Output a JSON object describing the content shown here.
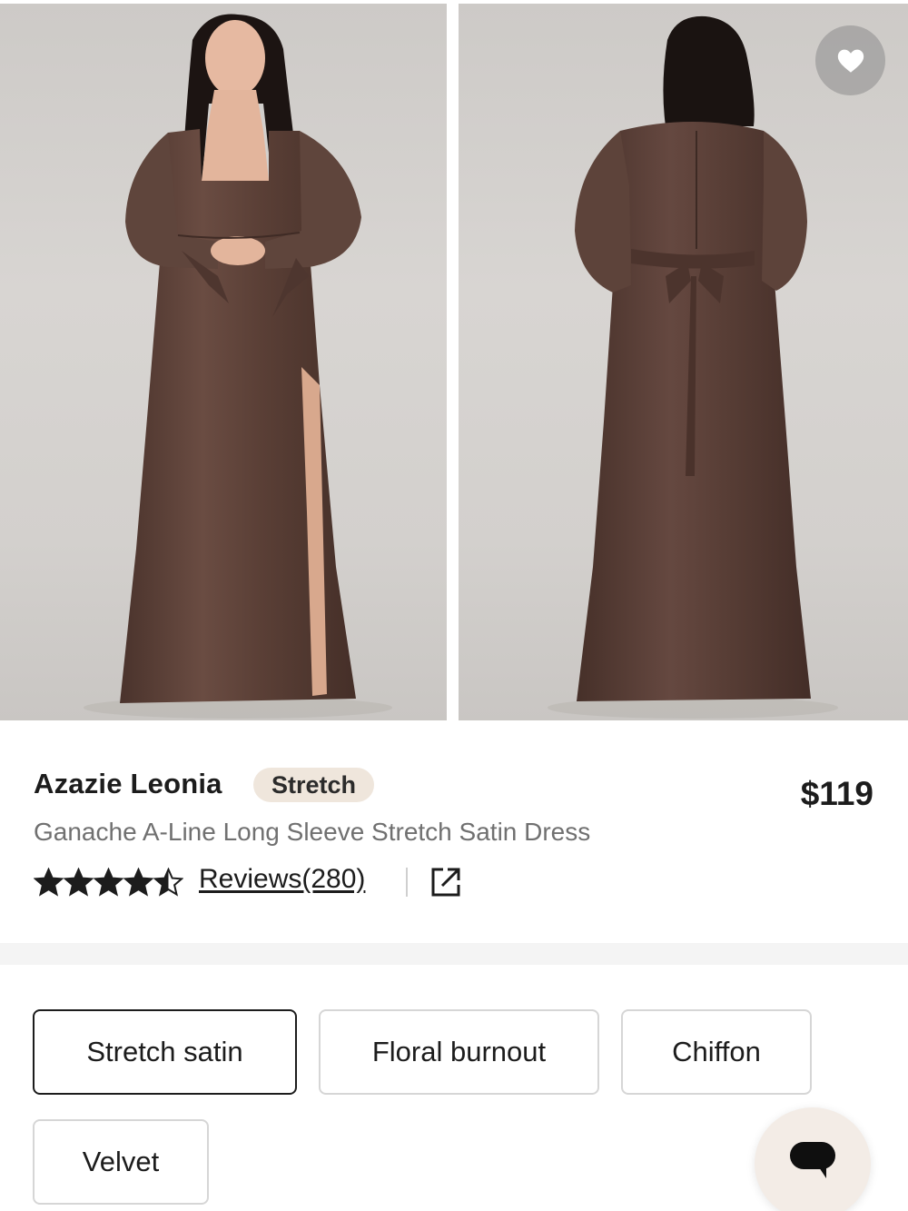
{
  "gallery": {
    "images": [
      {
        "alt": "front",
        "icon": "dress-front-photo"
      },
      {
        "alt": "back",
        "icon": "dress-back-photo"
      }
    ],
    "wishlist_icon": "heart-icon"
  },
  "product": {
    "brand_name": "Azazie Leonia",
    "badge": "Stretch",
    "price": "$119",
    "subtitle": "Ganache A-Line Long Sleeve Stretch Satin Dress",
    "rating": 4.5,
    "rating_max": 5,
    "reviews_label": "Reviews(280)",
    "share_icon": "external-link-icon"
  },
  "fabrics": {
    "options": [
      {
        "label": "Stretch satin",
        "selected": true
      },
      {
        "label": "Floral burnout",
        "selected": false
      },
      {
        "label": "Chiffon",
        "selected": false
      },
      {
        "label": "Velvet",
        "selected": false
      }
    ]
  },
  "chat": {
    "icon": "chat-bubble-icon"
  },
  "colors": {
    "dress": "#5b4139",
    "badge_bg": "#efe6dc",
    "chat_bg": "#f3ece6"
  }
}
